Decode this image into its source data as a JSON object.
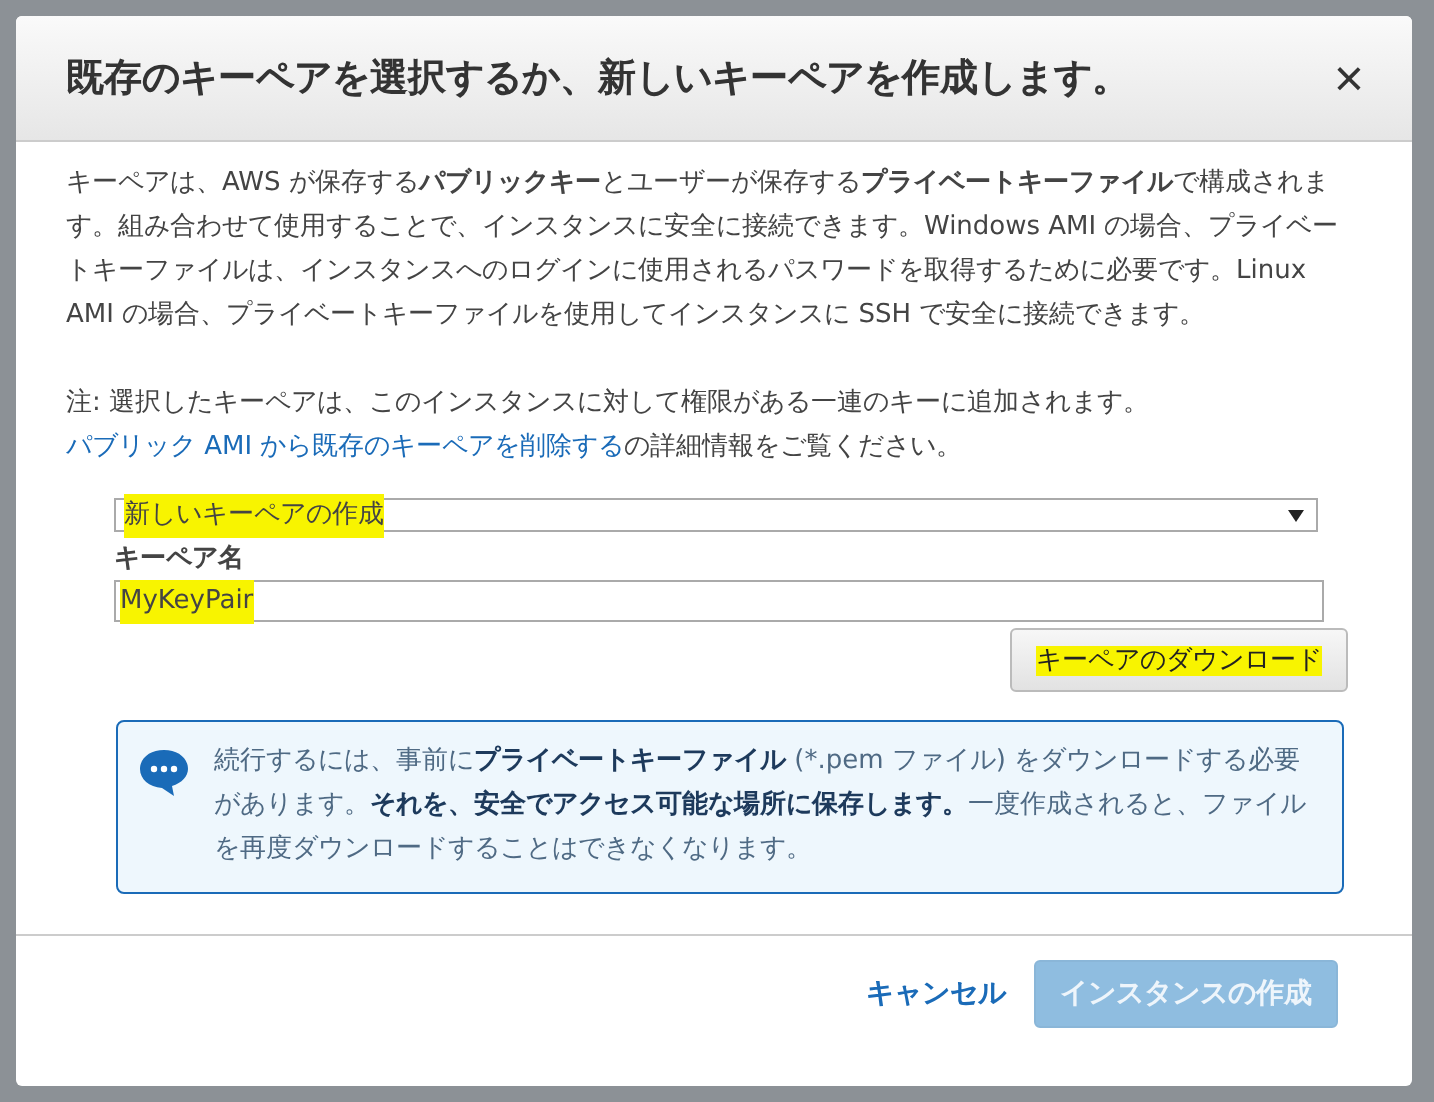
{
  "dialog": {
    "title": "既存のキーペアを選択するか、新しいキーペアを作成します。",
    "close": "×",
    "intro": "キーペアは、AWS が保存する**パブリックキー**とユーザーが保存する**プライベートキーファイル**で構成されます。組み合わせて使用することで、インスタンスに安全に接続できます。Windows AMI の場合、プライベートキーファイルは、インスタンスへのログインに使用されるパスワードを取得するために必要です。Linux AMI の場合、プライベートキーファイルを使用してインスタンスに SSH で安全に接続できます。",
    "note": {
      "before": "注: 選択したキーペアは、このインスタンスに対して権限がある一連のキーに追加されます。",
      "link": "パブリック AMI から既存のキーペアを削除する",
      "after": "の詳細情報をご覧ください。"
    },
    "select": {
      "value": "新しいキーペアの作成",
      "highlighted": true
    },
    "name_label": "キーペア名",
    "name_field": {
      "value": "MyKeyPair",
      "highlighted": true
    },
    "download_button": {
      "label": "キーペアのダウンロード",
      "highlighted": true
    },
    "info": "続行するには、事前に**プライベートキーファイル** (*.pem ファイル) をダウンロードする必要があります。**それを、安全でアクセス可能な場所に保存します。**一度作成されると、ファイルを再度ダウンロードすることはできなくなります。",
    "buttons": [
      {
        "label": "キャンセル",
        "kind": "link",
        "disabled": false
      },
      {
        "label": "インスタンスの作成",
        "kind": "primary",
        "disabled": true
      }
    ]
  }
}
